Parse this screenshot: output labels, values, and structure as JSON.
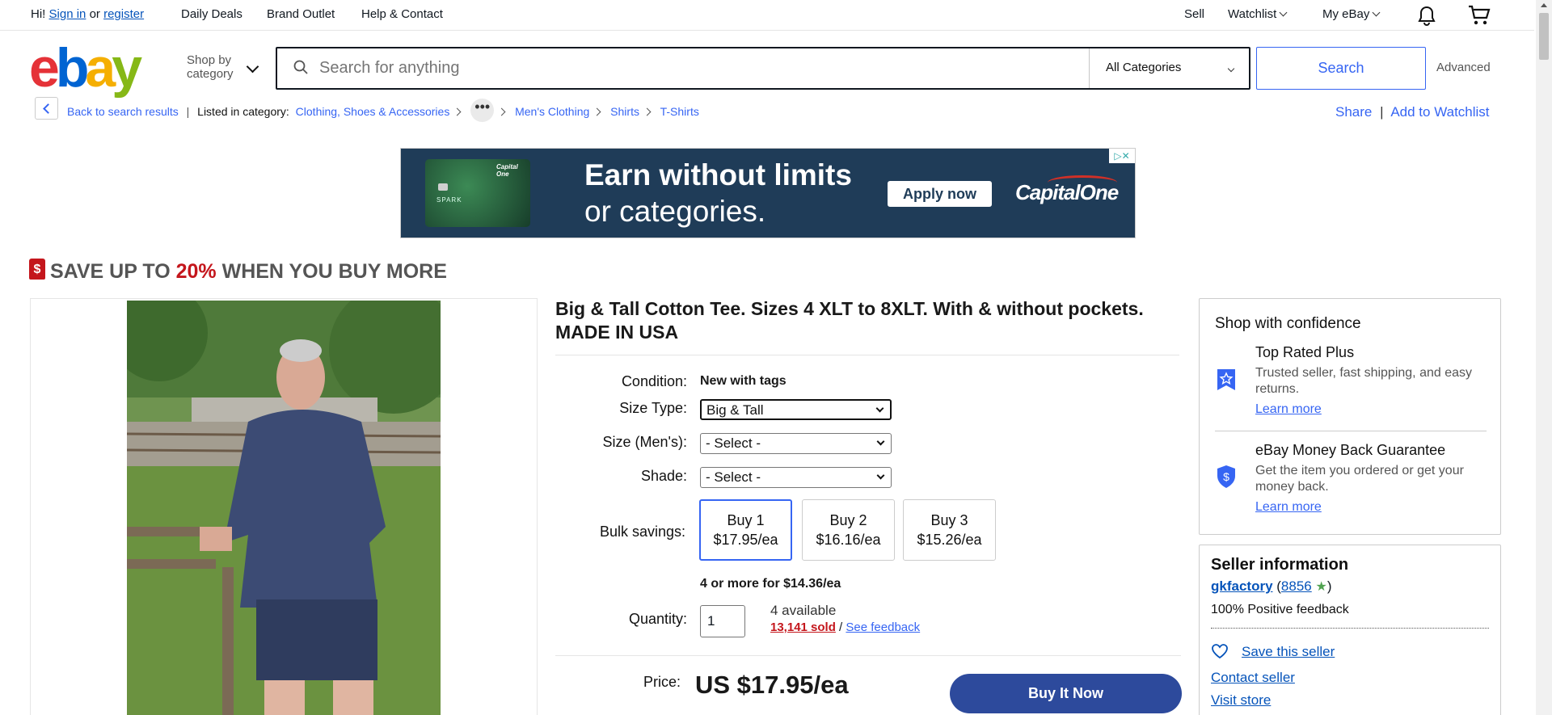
{
  "topbar": {
    "greeting": "Hi!",
    "sign_in": "Sign in",
    "or": "or",
    "register": "register",
    "daily_deals": "Daily Deals",
    "brand_outlet": "Brand Outlet",
    "help_contact": "Help & Contact",
    "sell": "Sell",
    "watchlist": "Watchlist",
    "my_ebay": "My eBay"
  },
  "header": {
    "logo_letters": [
      "e",
      "b",
      "a",
      "y"
    ],
    "logo_colors": [
      "#e53238",
      "#0064d2",
      "#f5af02",
      "#86b817"
    ],
    "shop_by_line1": "Shop by",
    "shop_by_line2": "category",
    "search_placeholder": "Search for anything",
    "category": "All Categories",
    "search_button": "Search",
    "advanced": "Advanced"
  },
  "breadcrumb": {
    "back": "Back to search results",
    "listed_in": "Listed in category:",
    "items": [
      "Clothing, Shoes & Accessories",
      "Men's Clothing",
      "Shirts",
      "T-Shirts"
    ],
    "more": "•••",
    "share": "Share",
    "add_to_watchlist": "Add to Watchlist",
    "divider": "|"
  },
  "ad": {
    "headline1": "Earn without limits",
    "headline2": "or categories.",
    "cta": "Apply now",
    "brand": "CapitalOne",
    "card_brand": "Capital One",
    "card_name": "SPARK"
  },
  "promo": {
    "icon_symbol": "$",
    "prefix": "SAVE UP TO ",
    "percent": "20%",
    "suffix": " WHEN YOU BUY MORE"
  },
  "product": {
    "title": "Big & Tall Cotton Tee. Sizes 4 XLT to 8XLT. With & without pockets. MADE IN USA",
    "condition_label": "Condition:",
    "condition": "New with tags",
    "size_type_label": "Size Type:",
    "size_type": "Big & Tall",
    "size_label": "Size (Men's):",
    "size": "- Select -",
    "shade_label": "Shade:",
    "shade": "- Select -",
    "bulk_label": "Bulk savings:",
    "bulk": [
      {
        "qty": "Buy 1",
        "price": "$17.95/ea"
      },
      {
        "qty": "Buy 2",
        "price": "$16.16/ea"
      },
      {
        "qty": "Buy 3",
        "price": "$15.26/ea"
      }
    ],
    "bulk_more": "4 or more for $14.36/ea",
    "quantity_label": "Quantity:",
    "quantity": "1",
    "available": "4 available",
    "sold": "13,141 sold",
    "slash": " / ",
    "see_feedback": "See feedback",
    "price_label": "Price:",
    "price": "US $17.95/ea",
    "buy_it_now": "Buy It Now"
  },
  "confidence": {
    "heading": "Shop with confidence",
    "items": [
      {
        "title": "Top Rated Plus",
        "desc": "Trusted seller, fast shipping, and easy returns.",
        "link": "Learn more",
        "icon": "top-rated-icon"
      },
      {
        "title": "eBay Money Back Guarantee",
        "desc": "Get the item you ordered or get your money back.",
        "link": "Learn more",
        "icon": "shield-dollar-icon"
      }
    ]
  },
  "seller": {
    "heading": "Seller information",
    "name": "gkfactory",
    "feedback_score": "8856",
    "positive": "100% Positive feedback",
    "save_seller": "Save this seller",
    "contact": "Contact seller",
    "visit_store": "Visit store"
  },
  "colors": {
    "accent": "#3665f3",
    "promo_red": "#c4161c",
    "buy_now_bg": "#2d4a9c",
    "ad_bg": "#1f3c58"
  }
}
